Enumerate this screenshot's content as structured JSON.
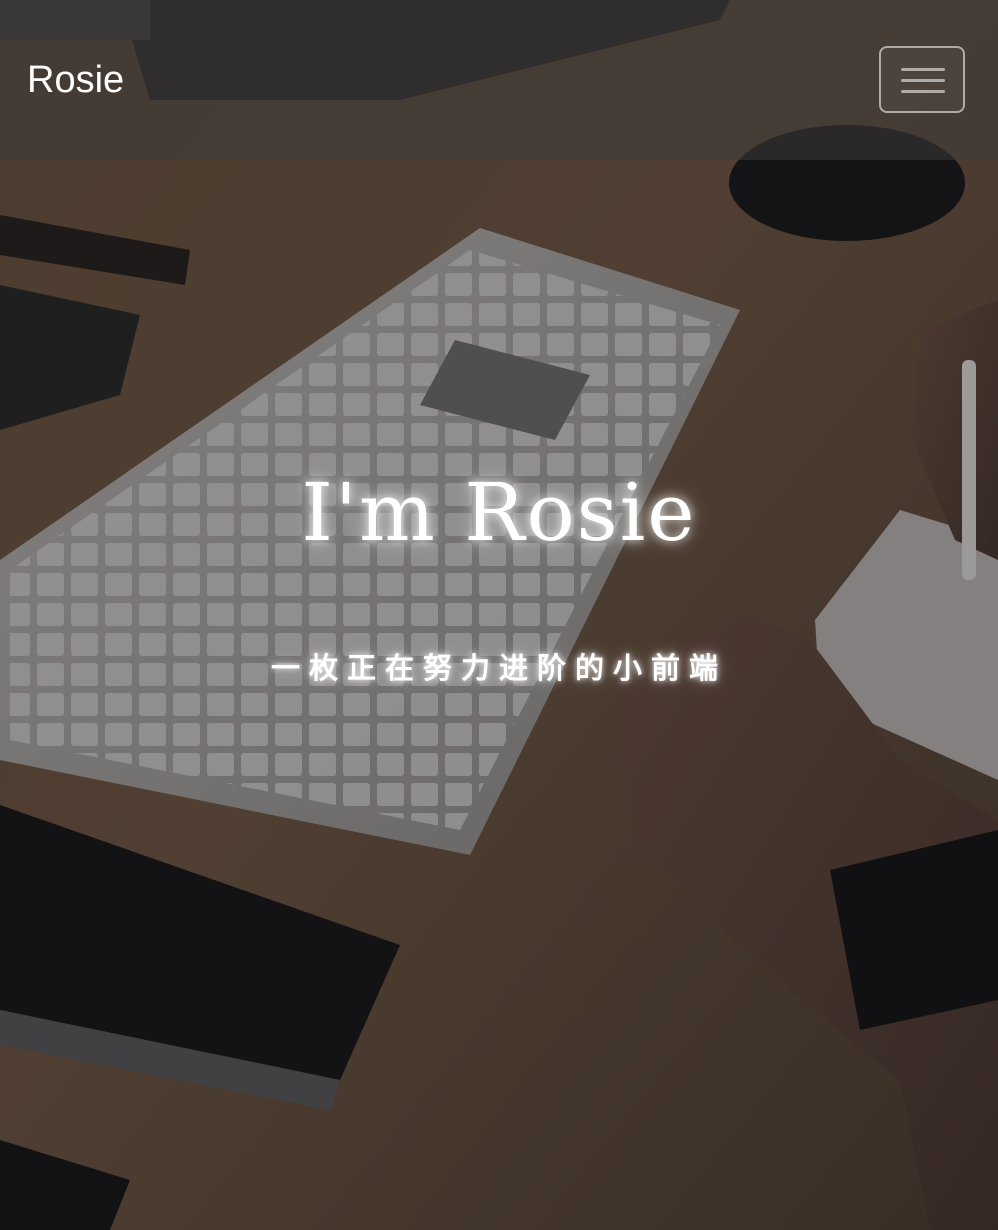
{
  "navbar": {
    "brand": "Rosie",
    "menu_toggle_icon": "hamburger-menu-icon"
  },
  "hero": {
    "title": "I'm Rosie",
    "subtitle": "一枚正在努力进阶的小前端",
    "background_description_icon": "desk-photo-background"
  },
  "colors": {
    "overlay": "#3e3a3a",
    "text": "#ffffff",
    "desk_wood": "#7a5f45"
  }
}
